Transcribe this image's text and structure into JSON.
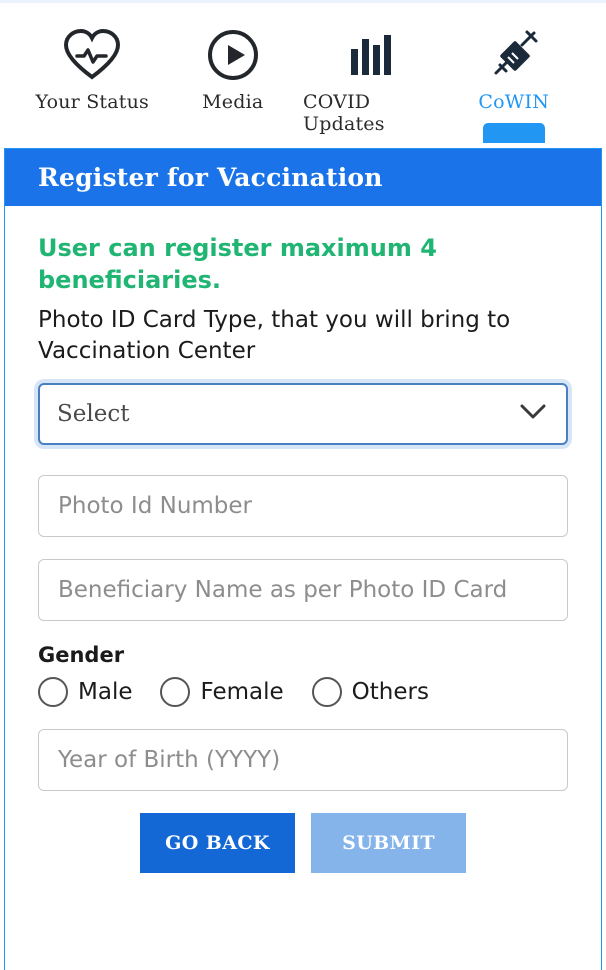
{
  "nav": {
    "items": [
      {
        "label": "Your Status",
        "icon": "heart-pulse-icon",
        "active": false
      },
      {
        "label": "Media",
        "icon": "play-circle-icon",
        "active": false
      },
      {
        "label": "COVID Updates",
        "icon": "bar-chart-icon",
        "active": false
      },
      {
        "label": "CoWIN",
        "icon": "syringe-icon",
        "active": true
      }
    ]
  },
  "card": {
    "title": "Register for Vaccination",
    "notice": "User can register maximum 4 beneficiaries.",
    "prompt": "Photo ID Card Type, that you will bring to Vaccination Center",
    "photo_id_type": {
      "value": "Select",
      "icon": "chevron-down-icon"
    },
    "photo_id_number": {
      "placeholder": "Photo Id Number",
      "value": ""
    },
    "beneficiary_name": {
      "placeholder": "Beneficiary Name as per Photo ID Card",
      "value": ""
    },
    "gender": {
      "label": "Gender",
      "options": [
        "Male",
        "Female",
        "Others"
      ],
      "selected": ""
    },
    "year_of_birth": {
      "placeholder": "Year of Birth (YYYY)",
      "value": ""
    },
    "buttons": {
      "back": "GO BACK",
      "submit": "SUBMIT"
    }
  },
  "colors": {
    "header_blue": "#1a73e8",
    "accent_blue": "#2196f3",
    "notice_green": "#21b573",
    "submit_blue": "#84b4ea",
    "back_blue": "#1368d6"
  }
}
